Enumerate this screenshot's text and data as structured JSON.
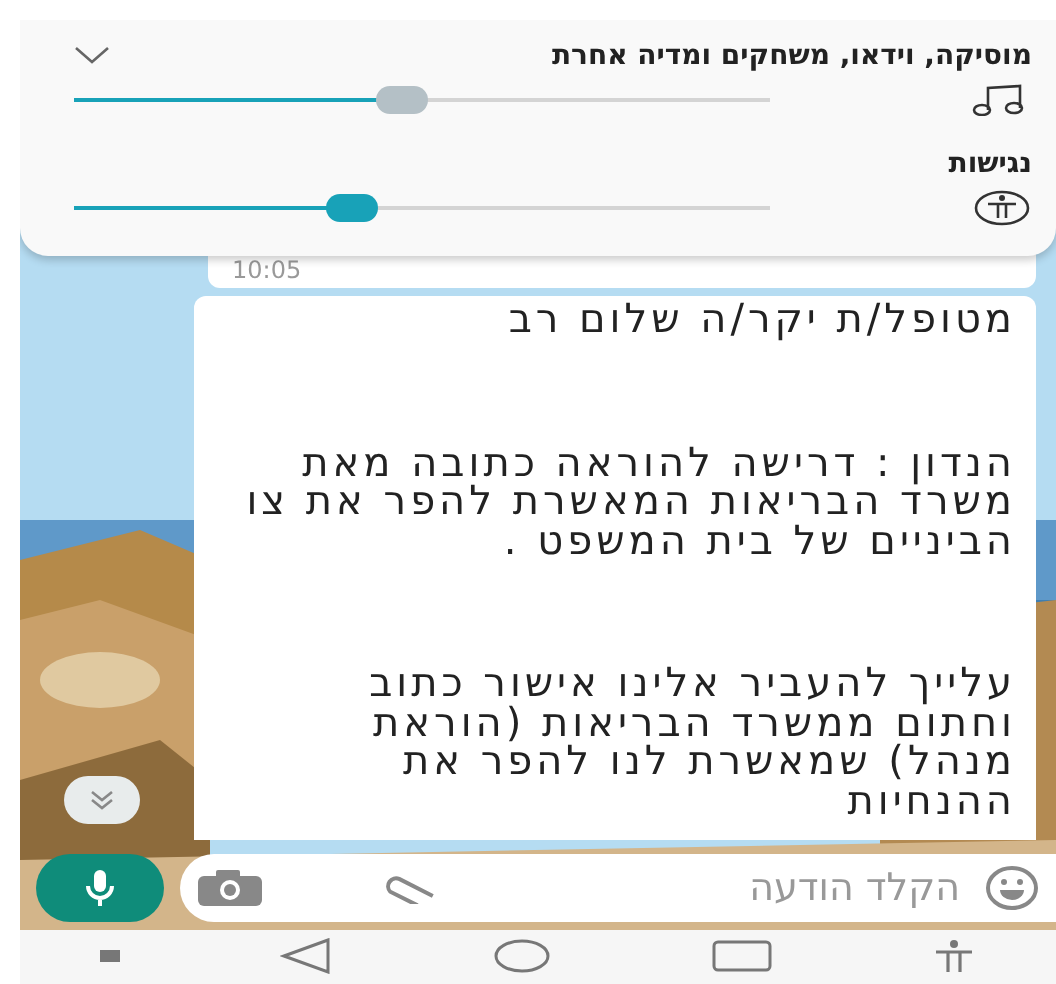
{
  "volume_panel": {
    "expanded": false,
    "sliders": [
      {
        "kind": "media",
        "label": "מוסיקה, וידאו, משחקים ומדיה אחרת",
        "level": 0.47,
        "active": false
      },
      {
        "kind": "accessibility",
        "label": "נגישות",
        "level": 0.4,
        "active": true
      }
    ]
  },
  "chat": {
    "previous_message": {
      "time": "10:05"
    },
    "message": {
      "paragraphs": [
        "מטופל/ת יקר/ה שלום רב",
        "הנדון : דרישה להוראה כתובה מאת משרד הבריאות המאשרת להפר את צו הביניים של בית המשפט .",
        "עלייך להעביר אלינו אישור כתוב וחתום ממשרד הבריאות (הוראת מנהל) שמאשרת לנו להפר את ההנחיות"
      ]
    }
  },
  "composer": {
    "placeholder": "הקלד הודעה"
  }
}
